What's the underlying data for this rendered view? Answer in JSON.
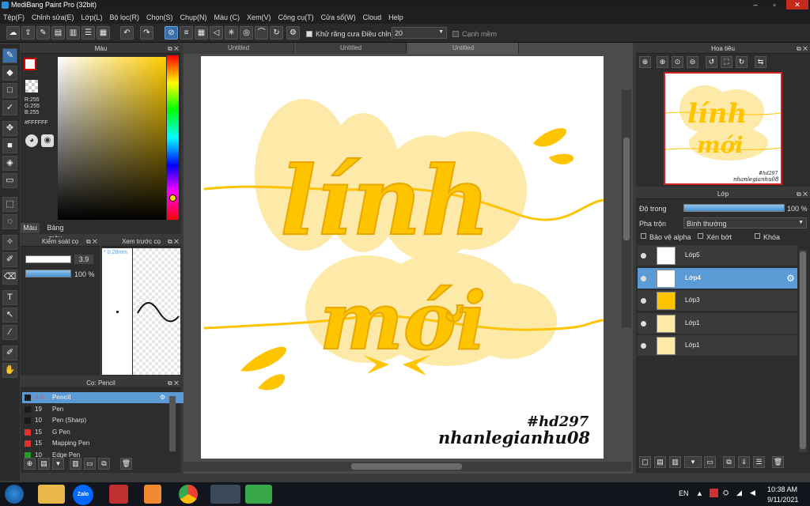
{
  "app": {
    "title": "MediBang Paint Pro (32bit)"
  },
  "window": {
    "min": "–",
    "max": "▫",
    "close": "✕"
  },
  "menu": [
    "Tệp(F)",
    "Chỉnh sửa(E)",
    "Lớp(L)",
    "Bộ lọc(R)",
    "Chọn(S)",
    "Chụp(N)",
    "Màu (C)",
    "Xem(V)",
    "Công cụ(T)",
    "Cửa sổ(W)",
    "Cloud",
    "Help"
  ],
  "toolbar": {
    "antialias_label": "Khử răng cưa",
    "adjust_label": "Điều chỉnh",
    "adjust_value": "20",
    "smooth_edge_label": "Cạnh mềm"
  },
  "color_panel": {
    "title": "Màu",
    "rgb_r": "R:255",
    "rgb_g": "G:255",
    "rgb_b": "B:255",
    "hex": "#FFFFFF",
    "tab_color": "Màu",
    "tab_palette": "Bảng màu"
  },
  "brush_control": {
    "title": "Kiểm soát cọ",
    "size": "3.9",
    "opacity": "100 %",
    "size_fill": 0.9,
    "opacity_fill": 1.0
  },
  "brush_preview": {
    "title": "Xem trước cọ",
    "size_label": "* 0.28mm"
  },
  "brush_panel": {
    "title": "Cọ: Pencil",
    "items": [
      {
        "size": "3.9",
        "name": "Pencil",
        "color": "#1a1a1a",
        "selected": true
      },
      {
        "size": "19",
        "name": "Pen",
        "color": "#1a1a1a",
        "selected": false
      },
      {
        "size": "10",
        "name": "Pen (Sharp)",
        "color": "#1a1a1a",
        "selected": false
      },
      {
        "size": "15",
        "name": "G Pen",
        "color": "#e03030",
        "selected": false
      },
      {
        "size": "15",
        "name": "Mapping Pen",
        "color": "#e03030",
        "selected": false
      },
      {
        "size": "10",
        "name": "Edge Pen",
        "color": "#20a020",
        "selected": false
      }
    ]
  },
  "canvas": {
    "tabs": [
      "Untitled",
      "Untitled",
      "Untitled"
    ],
    "word1": "lính",
    "word2": "mới",
    "signature_line1": "#hd297",
    "signature_line2": "nhanlegianhu08"
  },
  "navigator": {
    "title": "Hoa tiêu",
    "thumb_word1": "lính",
    "thumb_word2": "mới",
    "thumb_sig1": "#hd297",
    "thumb_sig2": "nhanlegianhu08"
  },
  "layers": {
    "title": "Lớp",
    "opacity_label": "Độ trong",
    "opacity_value": "100 %",
    "blend_label": "Pha trộn",
    "blend_value": "Bình thường",
    "protect_alpha": "Bảo vệ alpha",
    "clipping": "Xén bớt",
    "lock": "Khóa",
    "items": [
      {
        "name": "Lớp5",
        "selected": false
      },
      {
        "name": "Lớp4",
        "selected": true
      },
      {
        "name": "Lớp3",
        "selected": false
      },
      {
        "name": "Lớp1",
        "selected": false
      },
      {
        "name": "Lớp1",
        "selected": false
      }
    ]
  },
  "taskbar": {
    "lang": "EN",
    "time": "10:38 AM",
    "date": "9/11/2021",
    "zalo": "Zalo"
  },
  "colors": {
    "accent": "#5b9bd5",
    "letter": "#ffc400",
    "glow": "#fde9a8"
  }
}
